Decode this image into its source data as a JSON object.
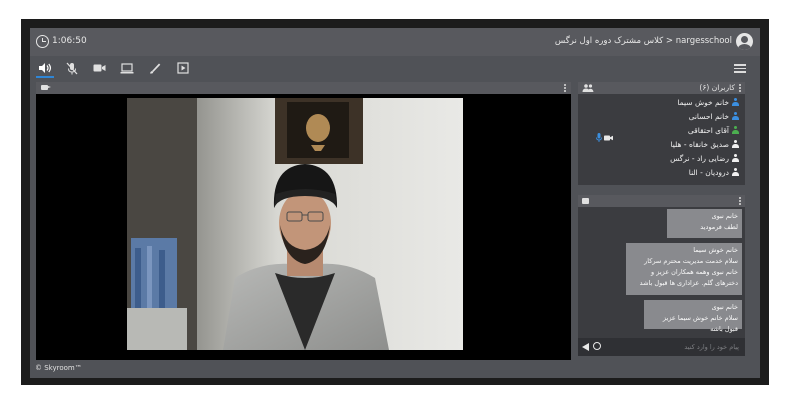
{
  "topbar": {
    "timer": "1:06:50",
    "room_title": "nargesschool < کلاس مشترک دوره اول نرگس",
    "icons": [
      "clock-icon",
      "account-icon"
    ]
  },
  "toolbar": {
    "icons": [
      "speaker-icon",
      "microphone-off-icon",
      "camera-icon",
      "screen-share-icon",
      "pen-icon",
      "presentation-icon",
      "menu-icon"
    ],
    "accent_color": "#2f86d6"
  },
  "users": {
    "title": "کاربران (۶)",
    "list": [
      {
        "name": "خانم خوش سیما",
        "color": "#3b8fe0"
      },
      {
        "name": "خانم احسانی",
        "color": "#3b8fe0"
      },
      {
        "name": "آقای احتقاقی",
        "color": "#4caf50"
      },
      {
        "name": "صدیق خانقاه - هلیا",
        "color": "#f0f0f0"
      },
      {
        "name": "رضایی راد - نرگس",
        "color": "#f0f0f0"
      },
      {
        "name": "درودیان - النا",
        "color": "#f0f0f0"
      }
    ]
  },
  "chat": {
    "messages": [
      {
        "sender": "خانم نبوی",
        "text": "لطف فرمودید"
      },
      {
        "sender": "خانم خوش سیما",
        "text": "سلام خدمت مدیریت محترم سرکار خانم نبوی وهمه همکاران عزیز و دخترهای گلم. عزاداری ها قبول باشد"
      },
      {
        "sender": "خانم نبوی",
        "text": "سلام خانم خوش سیما عزیز قبول باشه"
      }
    ],
    "input_placeholder": "پیام خود را وارد کنید"
  },
  "footer": {
    "brand": "© Skyroom™"
  },
  "colors": {
    "background": "#505257",
    "panel": "#3b3c40",
    "header": "#58595e",
    "bubble": "#898a8e"
  }
}
